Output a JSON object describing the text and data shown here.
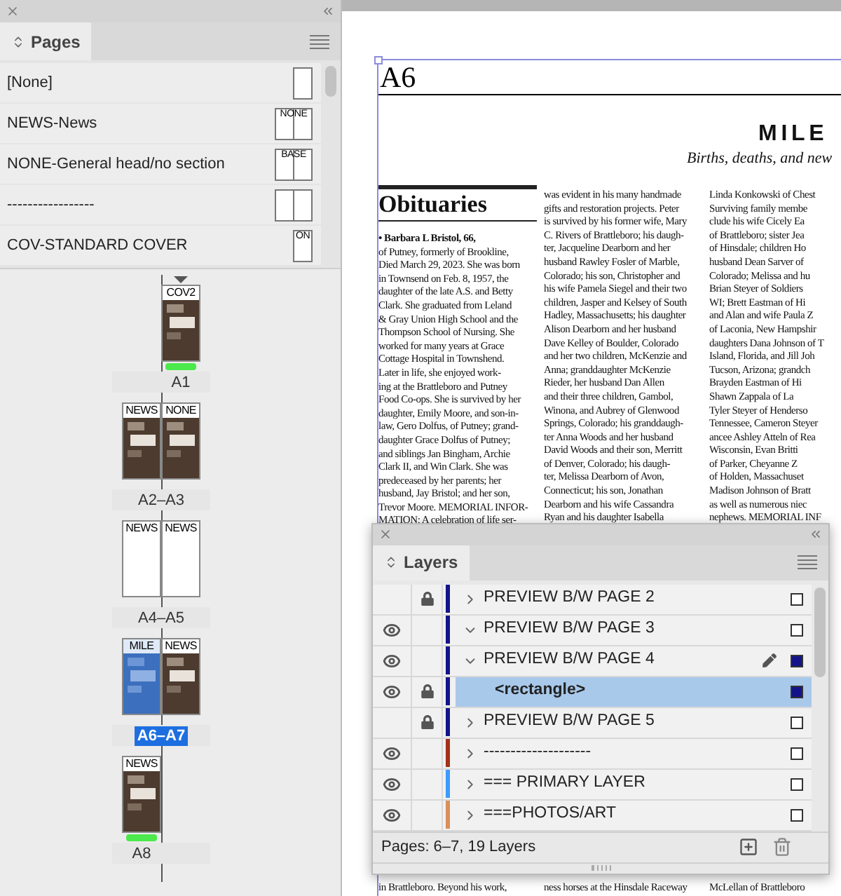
{
  "pages_panel": {
    "tab": "Pages",
    "masters": [
      {
        "name": "[None]",
        "kind": "single"
      },
      {
        "name": "NEWS-News",
        "kind": "spread",
        "thumb_label": "NONE"
      },
      {
        "name": "NONE-General head/no section",
        "kind": "spread",
        "thumb_label": "BASE"
      },
      {
        "name": "-----------------",
        "kind": "spread"
      },
      {
        "name": "COV-STANDARD COVER",
        "kind": "single",
        "thumb_label": "ON"
      }
    ],
    "spreads": [
      {
        "label": "A1",
        "selected": false,
        "start": true,
        "kind": "recto",
        "pages": [
          {
            "master": "COV2",
            "kind": "photos",
            "targeted": false,
            "color": "#4ce94c"
          }
        ]
      },
      {
        "label": "A2–A3",
        "selected": false,
        "start": false,
        "kind": "pair",
        "pages": [
          {
            "master": "NEWS",
            "kind": "photos",
            "targeted": false
          },
          {
            "master": "NONE",
            "kind": "photos",
            "targeted": false
          }
        ]
      },
      {
        "label": "A4–A5",
        "selected": false,
        "start": false,
        "kind": "pair",
        "pages": [
          {
            "master": "NEWS",
            "kind": "blank",
            "targeted": false
          },
          {
            "master": "NEWS",
            "kind": "blank",
            "targeted": false
          }
        ]
      },
      {
        "label": "A6–A7",
        "selected": true,
        "start": false,
        "kind": "pair",
        "pages": [
          {
            "master": "MILE",
            "kind": "photos",
            "targeted": true
          },
          {
            "master": "NEWS",
            "kind": "photos",
            "targeted": false
          }
        ]
      },
      {
        "label": "A8",
        "selected": false,
        "start": false,
        "kind": "verso",
        "pages": [
          {
            "master": "NEWS",
            "kind": "photos",
            "targeted": false,
            "color": "#4ce94c"
          }
        ]
      }
    ]
  },
  "document": {
    "page_number": "A6",
    "section_title": "MILE",
    "section_subtitle": "Births, deaths, and new",
    "heading": "Obituaries",
    "columns": [
      {
        "lines": [
          "**• Barbara L Bristol, 66,**",
          "of Putney, formerly of Brookline,",
          "Died March 29, 2023. She was born",
          "in Townsend on Feb. 8, 1957, the",
          "daughter of the late A.S. and Betty",
          "Clark. She graduated from Leland",
          "& Gray Union High School and the",
          "Thompson School of Nursing. She",
          "worked for many years at Grace",
          "Cottage Hospital in Townshend.",
          "Later in life, she enjoyed work-",
          "ing at the Brattleboro and Putney",
          "Food Co-ops. She is survived by her",
          "daughter, Emily Moore, and son-in-",
          "law, Gero Dolfus, of Putney; grand-",
          "daughter Grace Dolfus of Putney;",
          "and siblings Jan Bingham, Archie",
          "Clark II, and Win Clark. She was",
          "predeceased by her parents; her",
          "husband, Jay Bristol; and her son,",
          "Trevor Moore. MEMORIAL INFOR-",
          "MATION: A celebration of life ser-"
        ],
        "lower_line": "in Brattleboro. Beyond his work,"
      },
      {
        "lines": [
          "was evident in his many handmade",
          "gifts and restoration projects. Peter",
          "is survived by his former wife, Mary",
          "C. Rivers of Brattleboro; his daugh-",
          "ter, Jacqueline Dearborn and her",
          "husband Rawley Fosler of Marble,",
          "Colorado; his son, Christopher and",
          "his wife Pamela Siegel and their two",
          "children, Jasper and Kelsey of South",
          "Hadley, Massachusetts; his daughter",
          "Alison Dearborn and her husband",
          "Dave Kelley of Boulder, Colorado",
          "and her two children, McKenzie and",
          "Anna; granddaughter McKenzie",
          "Rieder, her husband Dan Allen",
          "and their three children, Gambol,",
          "Winona, and Aubrey of Glenwood",
          "Springs, Colorado; his granddaugh-",
          "ter Anna Woods and her husband",
          "David Woods and their son, Merritt",
          "of Denver, Colorado; his daugh-",
          "ter, Melissa Dearborn of Avon,",
          "Connecticut; his son, Jonathan",
          "Dearborn and his wife Cassandra",
          "Ryan and his daughter Isabella"
        ],
        "lower_line": "ness horses at the Hinsdale Raceway"
      },
      {
        "lines": [
          "Linda Konkowski of Chest",
          "Surviving family membe",
          "clude his wife Cicely Ea",
          "of Brattleboro; sister Jea",
          "of Hinsdale; children Ho",
          "husband Dean Sarver of",
          "Colorado; Melissa and hu",
          "Brian Steyer of Soldiers",
          "WI; Brett Eastman of Hi",
          "and Alan and wife Paula Z",
          "of Laconia, New Hampshir",
          "daughters Dana Johnson of T",
          "Island, Florida, and Jill Joh",
          "Tucson, Arizona; grandch",
          "Brayden Eastman of Hi",
          "Shawn Zappala of La",
          "Tyler Steyer of Henderso",
          "Tennessee, Cameron Steyer",
          "ancee Ashley Atteln of Rea",
          "Wisconsin, Evan Britti",
          "of Parker, Cheyanne Z",
          "of Holden, Massachuset",
          "Madison Johnson of Bratt",
          "as well as numerous niec",
          "nephews. MEMORIAL INF"
        ],
        "lower_line": "McLellan of Brattleboro"
      }
    ]
  },
  "layers_panel": {
    "tab": "Layers",
    "status": "Pages: 6–7, 19 Layers",
    "layers": [
      {
        "name": "PREVIEW B/W PAGE 2",
        "kind": "layer",
        "visible": false,
        "locked": true,
        "color": "#14148a",
        "expanded": false,
        "selected": false,
        "drawing": false,
        "filled": false
      },
      {
        "name": "PREVIEW B/W PAGE 3",
        "kind": "layer",
        "visible": true,
        "locked": false,
        "color": "#14148a",
        "expanded": true,
        "selected": false,
        "drawing": false,
        "filled": false
      },
      {
        "name": "PREVIEW B/W PAGE 4",
        "kind": "layer",
        "visible": true,
        "locked": false,
        "color": "#14148a",
        "expanded": true,
        "selected": false,
        "drawing": true,
        "filled": true,
        "children": [
          {
            "name": "<rectangle>",
            "kind": "object",
            "visible": true,
            "locked": true,
            "color": "#14148a",
            "selected": true,
            "drawing": false,
            "filled": true
          }
        ]
      },
      {
        "name": "PREVIEW B/W PAGE 5",
        "kind": "layer",
        "visible": false,
        "locked": true,
        "color": "#14148a",
        "expanded": false,
        "selected": false,
        "drawing": false,
        "filled": false
      },
      {
        "name": "--------------------",
        "kind": "layer",
        "visible": true,
        "locked": false,
        "color": "#a2321a",
        "expanded": false,
        "selected": false,
        "drawing": false,
        "filled": false
      },
      {
        "name": "=== PRIMARY LAYER",
        "kind": "layer",
        "visible": true,
        "locked": false,
        "color": "#3a9cff",
        "expanded": false,
        "selected": false,
        "drawing": false,
        "filled": false
      },
      {
        "name": "===PHOTOS/ART",
        "kind": "layer",
        "visible": true,
        "locked": false,
        "color": "#d98f5a",
        "expanded": false,
        "selected": false,
        "drawing": false,
        "filled": false
      }
    ]
  }
}
